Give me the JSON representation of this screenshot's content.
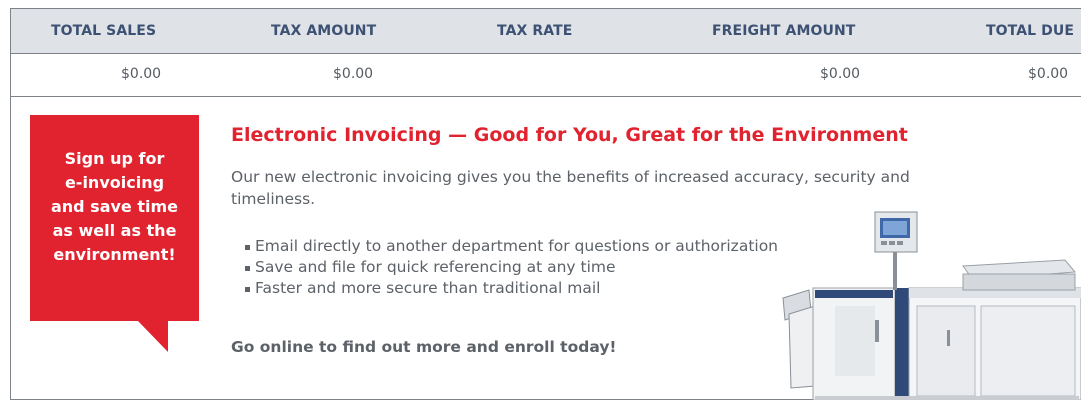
{
  "table": {
    "headers": [
      "TOTAL SALES",
      "TAX AMOUNT",
      "TAX RATE",
      "FREIGHT AMOUNT",
      "TOTAL DUE"
    ],
    "values": {
      "total_sales": "$0.00",
      "tax_amount": "$0.00",
      "tax_rate": "",
      "freight_amount": "$0.00",
      "total_due": "$0.00"
    }
  },
  "callout": {
    "lines": [
      "Sign up for",
      "e-invoicing",
      "and save time",
      "as well as the",
      "environment!"
    ]
  },
  "promo": {
    "title": "Electronic Invoicing — Good for You, Great for the Environment",
    "body": "Our new electronic invoicing gives you the benefits of increased accuracy, security and timeliness.",
    "bullets": [
      "Email directly to another department for questions or authorization",
      "Save and file for quick referencing at any time",
      "Faster and more secure than traditional mail"
    ],
    "cta": "Go online to find out more and enroll today!"
  },
  "colors": {
    "accent_red": "#e12330",
    "header_text_blue": "#3c5173",
    "header_bg": "#dfe2e6",
    "body_text": "#5c6268"
  },
  "image": {
    "icon": "copier-printer-image"
  }
}
